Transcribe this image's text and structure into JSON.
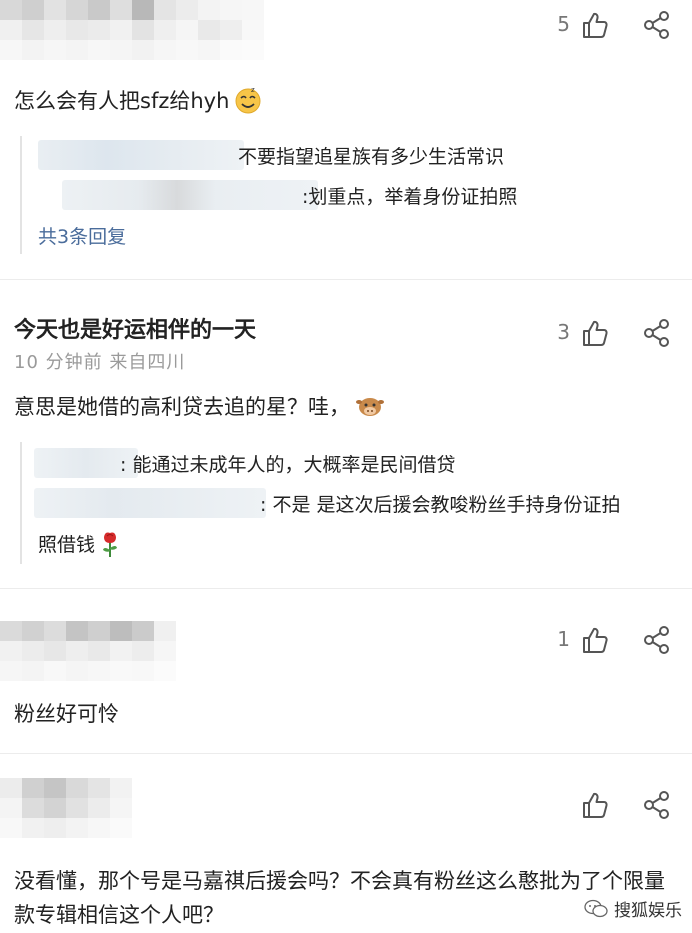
{
  "comments": [
    {
      "like_count": "5",
      "text": "怎么会有人把sfz给hyh",
      "replies": [
        {
          "text": "不要指望追星族有多少生活常识"
        },
        {
          "text": ":划重点，举着身份证拍照"
        }
      ],
      "reply_more": "共3条回复"
    },
    {
      "username": "今天也是好运相伴的一天",
      "meta": "10 分钟前  来自四川",
      "like_count": "3",
      "text": "意思是她借的高利贷去追的星？哇，",
      "replies": [
        {
          "text": ": 能通过未成年人的，大概率是民间借贷"
        },
        {
          "text": ": 不是 是这次后援会教唆粉丝手持身份证拍"
        },
        {
          "text": "照借钱"
        }
      ]
    },
    {
      "like_count": "1",
      "text": "粉丝好可怜"
    },
    {
      "like_count": "",
      "text": "没看懂，那个号是马嘉祺后援会吗？不会真有粉丝这么憨批为了个限量款专辑相信这个人吧？"
    }
  ],
  "watermark": {
    "text": "搜狐娱乐"
  },
  "icons": {
    "like": "thumbs-up-icon",
    "share": "share-icon"
  }
}
